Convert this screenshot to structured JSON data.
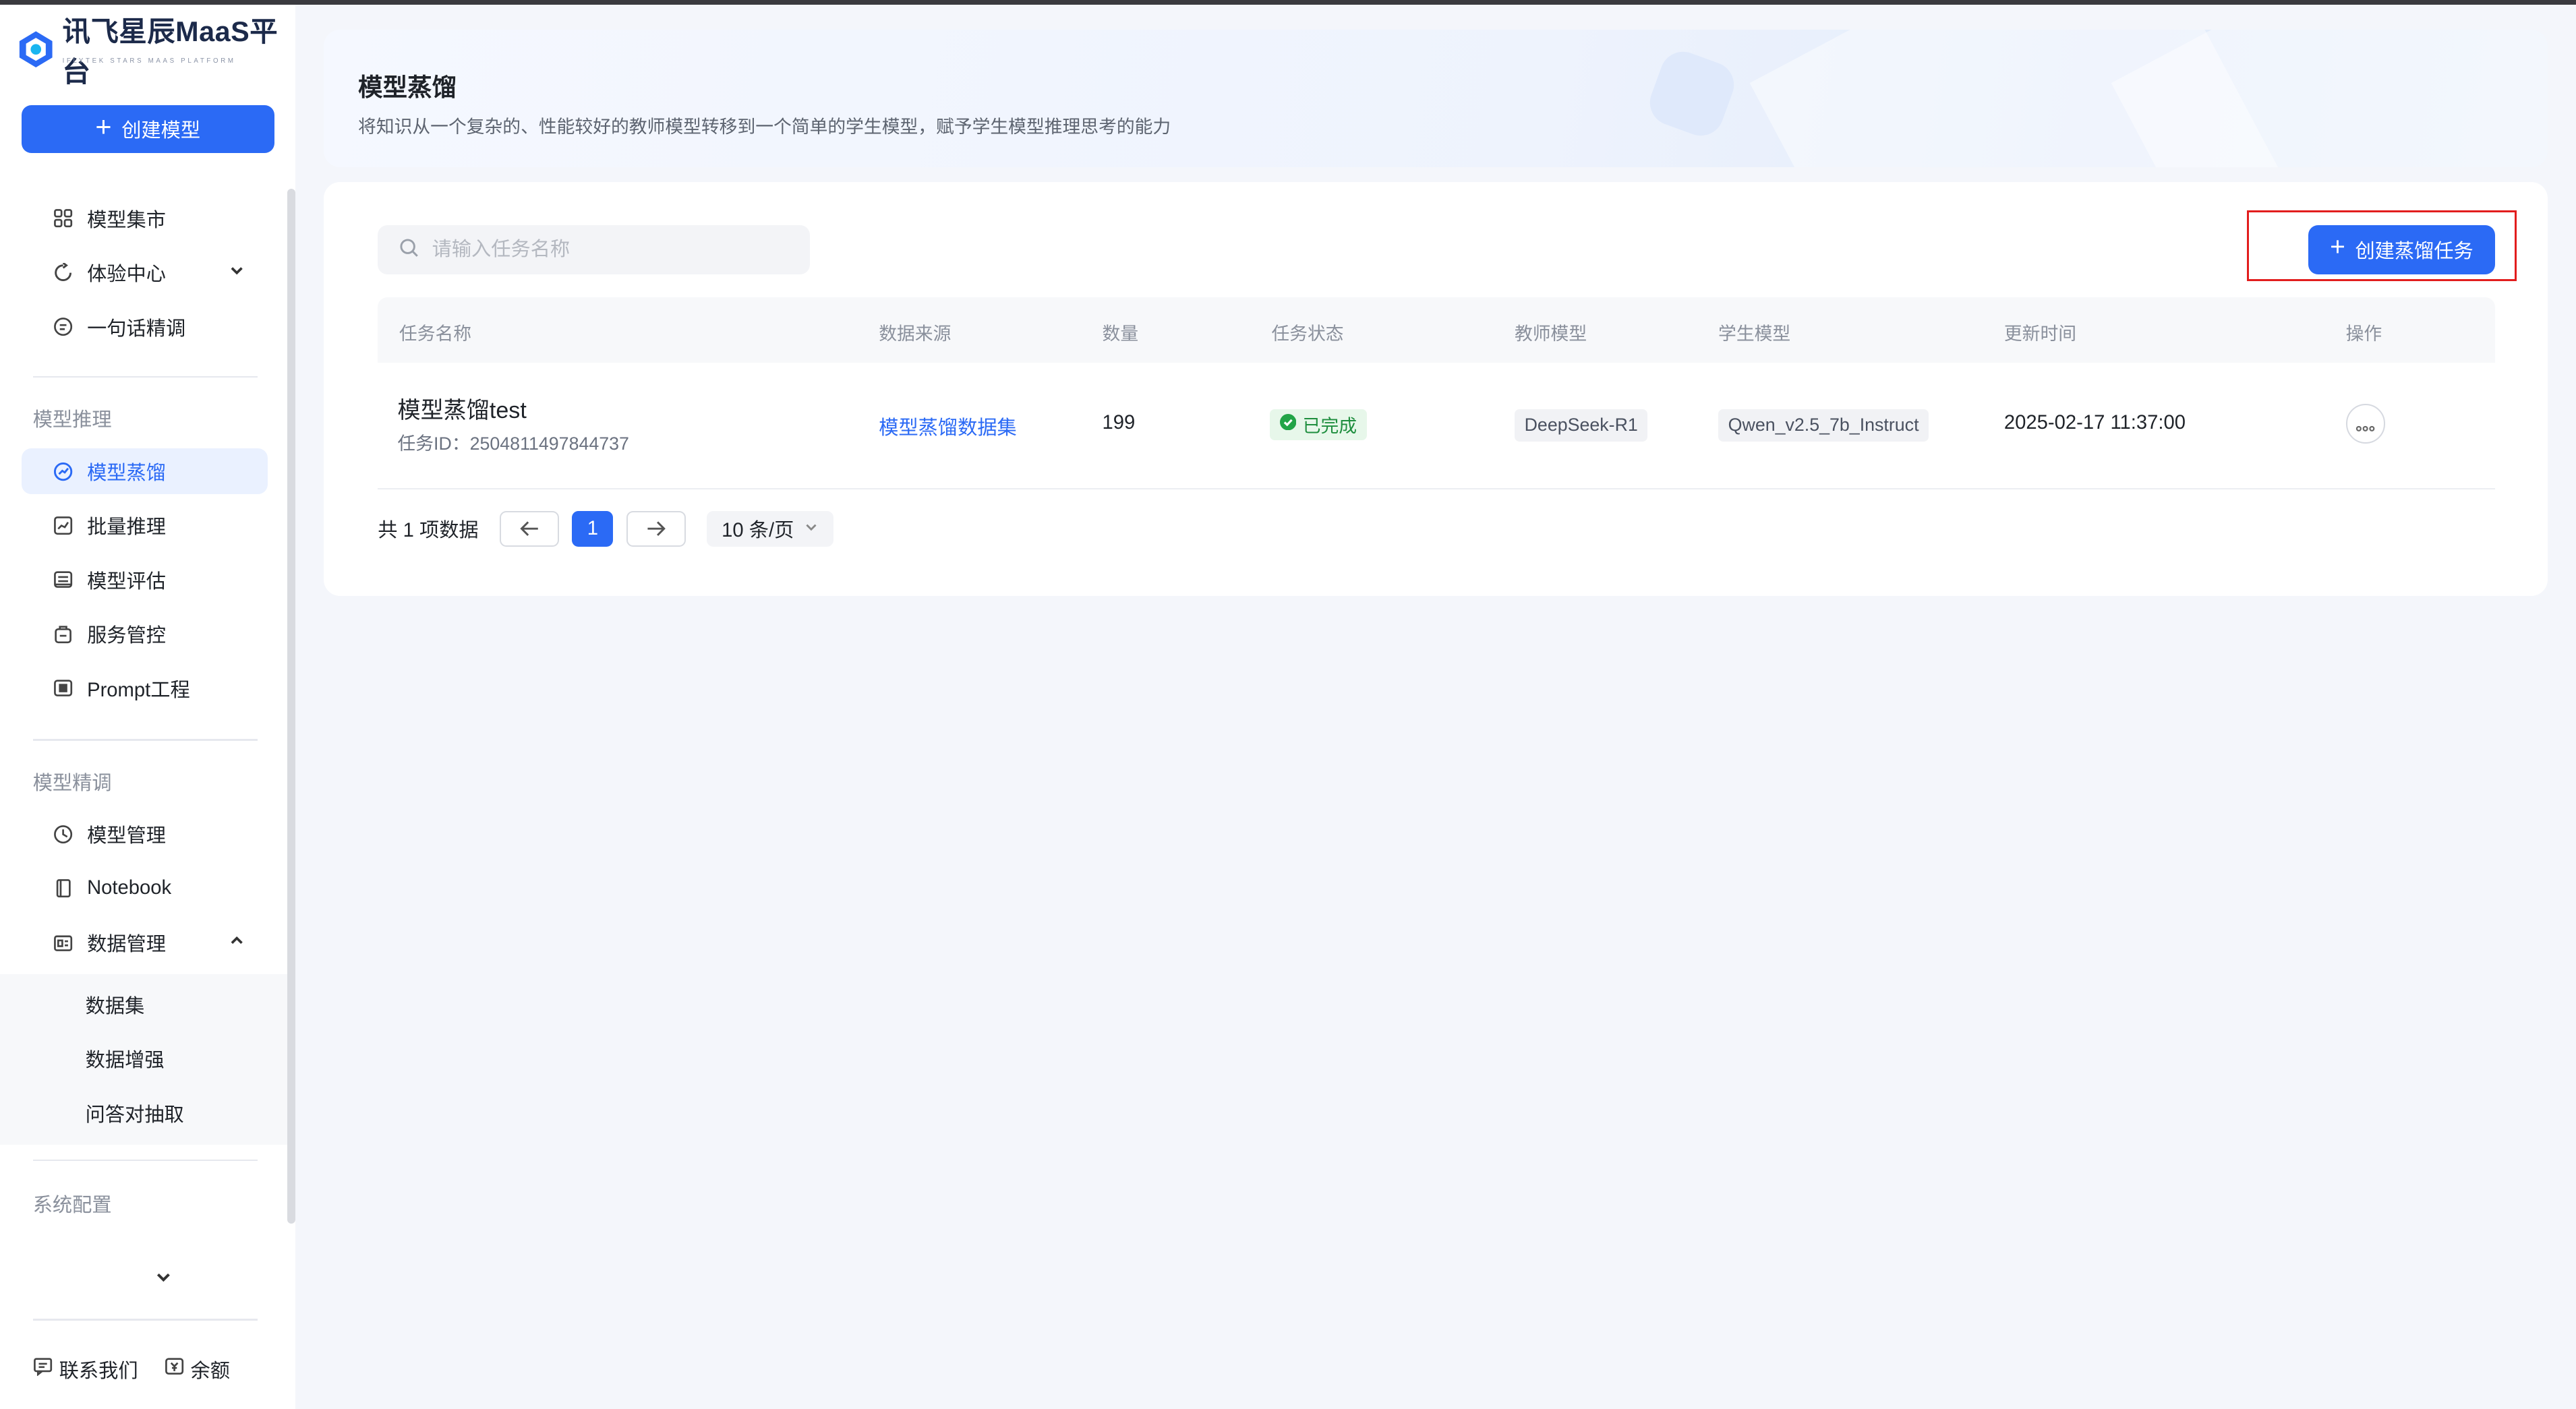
{
  "brand": {
    "name": "讯飞星辰MaaS平台",
    "subtitle": "IFLYTEK STARS MAAS PLATFORM"
  },
  "sidebar": {
    "create_button": "创建模型",
    "top_items": [
      {
        "label": "模型集市",
        "icon": "grid-icon"
      },
      {
        "label": "体验中心",
        "icon": "refresh-icon"
      },
      {
        "label": "一句话精调",
        "icon": "chat-icon"
      }
    ],
    "section_inference": "模型推理",
    "inference_items": [
      {
        "label": "模型蒸馏",
        "icon": "distill-icon",
        "active": true
      },
      {
        "label": "批量推理",
        "icon": "chart-icon"
      },
      {
        "label": "模型评估",
        "icon": "eval-icon"
      },
      {
        "label": "服务管控",
        "icon": "service-icon"
      },
      {
        "label": "Prompt工程",
        "icon": "prompt-icon"
      }
    ],
    "section_finetune": "模型精调",
    "finetune_items": [
      {
        "label": "模型管理",
        "icon": "model-icon"
      },
      {
        "label": "Notebook",
        "icon": "notebook-icon"
      },
      {
        "label": "数据管理",
        "icon": "data-icon"
      }
    ],
    "data_sub_items": [
      "数据集",
      "数据增强",
      "问答对抽取"
    ],
    "section_system": "系统配置",
    "footer": {
      "contact": "联系我们",
      "balance": "余额"
    }
  },
  "banner": {
    "title": "模型蒸馏",
    "description": "将知识从一个复杂的、性能较好的教师模型转移到一个简单的学生模型，赋予学生模型推理思考的能力"
  },
  "toolbar": {
    "search_placeholder": "请输入任务名称",
    "create_task": "创建蒸馏任务"
  },
  "table": {
    "headers": [
      "任务名称",
      "数据来源",
      "数量",
      "任务状态",
      "教师模型",
      "学生模型",
      "更新时间",
      "操作"
    ],
    "rows": [
      {
        "name": "模型蒸馏test",
        "task_id": "任务ID：2504811497844737",
        "source": "模型蒸馏数据集",
        "count": "199",
        "status": "已完成",
        "teacher": "DeepSeek-R1",
        "student": "Qwen_v2.5_7b_Instruct",
        "updated": "2025-02-17 11:37:00"
      }
    ]
  },
  "pagination": {
    "total": "共 1 项数据",
    "current_page": "1",
    "page_size": "10 条/页"
  },
  "colors": {
    "primary": "#2b6af5",
    "success": "#1e8e3e",
    "highlight": "#e21d1d"
  }
}
